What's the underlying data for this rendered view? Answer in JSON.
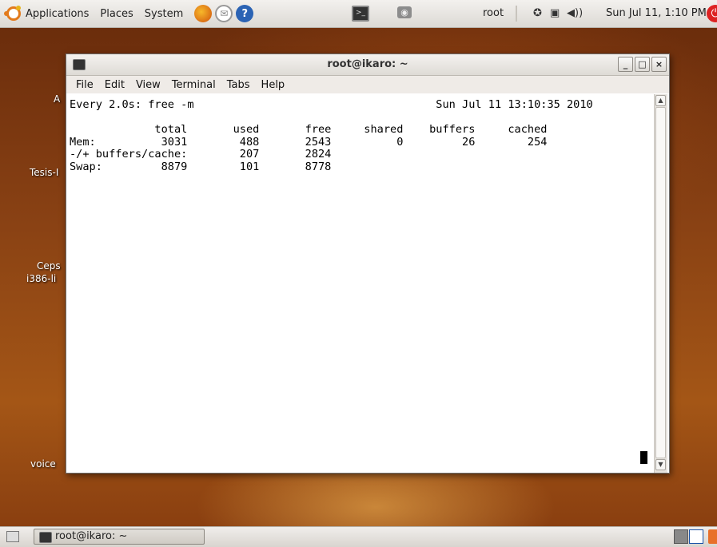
{
  "top_panel": {
    "menus": [
      "Applications",
      "Places",
      "System"
    ],
    "user": "root",
    "clock": "Sun Jul 11,  1:10 PM"
  },
  "desktop": {
    "labels": [
      "A",
      "Tesis-I",
      "Ceps",
      "i386-li",
      "voice"
    ]
  },
  "window": {
    "title": "root@ikaro: ~",
    "buttons": {
      "minimize": "_",
      "maximize": "□",
      "close": "×"
    },
    "menu": [
      "File",
      "Edit",
      "View",
      "Terminal",
      "Tabs",
      "Help"
    ]
  },
  "terminal": {
    "lines": [
      "Every 2.0s: free -m                                     Sun Jul 11 13:10:35 2010",
      "",
      "             total       used       free     shared    buffers     cached",
      "Mem:          3031        488       2543          0         26        254",
      "-/+ buffers/cache:        207       2824",
      "Swap:         8879        101       8778"
    ]
  },
  "taskbar": {
    "task_label": "root@ikaro: ~"
  },
  "icons": {
    "ubuntu": "ubuntu-logo-icon",
    "firefox": "firefox-icon",
    "mail": "mail-icon",
    "help": "help-icon",
    "terminal": "terminal-icon",
    "screenshot": "screenshot-icon",
    "power": "power-icon"
  },
  "colors": {
    "ubuntu_orange": "#e27a1c",
    "panel": "#dcd9d4",
    "terminal_bg": "#ffffff"
  }
}
